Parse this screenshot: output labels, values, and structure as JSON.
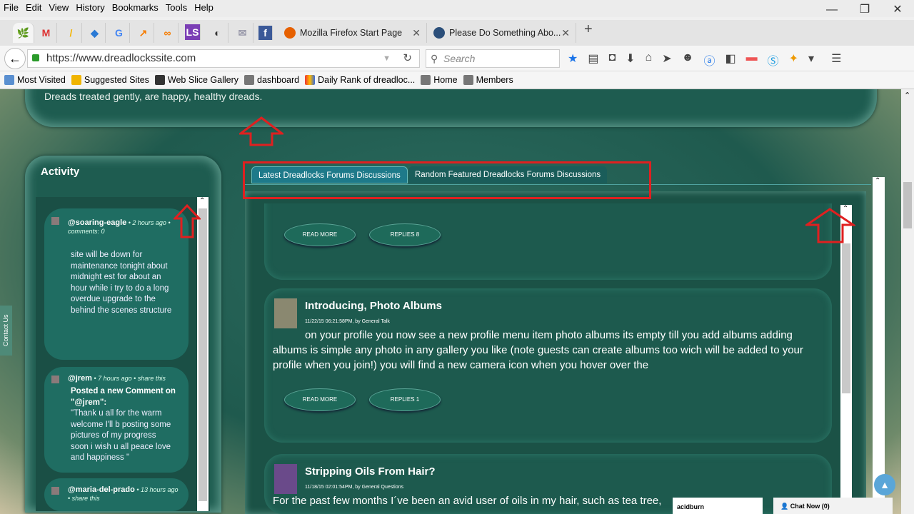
{
  "menu": [
    "File",
    "Edit",
    "View",
    "History",
    "Bookmarks",
    "Tools",
    "Help"
  ],
  "pinned_tabs": [
    "dreadlocks",
    "gmail",
    "adwords",
    "teamviewer",
    "google",
    "analytics",
    "link",
    "ls",
    "globe",
    "mail",
    "facebook"
  ],
  "tabs": [
    {
      "label": "Mozilla Firefox Start Page",
      "close": "✕"
    },
    {
      "label": "Please Do Something Abo...",
      "close": "✕"
    }
  ],
  "new_tab": "+",
  "url": "https://www.dreadlockssite.com",
  "search_placeholder": "Search",
  "bookmarks": [
    "Most Visited",
    "Suggested Sites",
    "Web Slice Gallery",
    "dashboard",
    "Daily Rank of dreadloc...",
    "Home",
    "Members"
  ],
  "page": {
    "top_text": "Dreads treated gently, are happy, healthy dreads.",
    "contact": "Contact Us",
    "activity": {
      "title": "Activity",
      "items": [
        {
          "user": "@soaring-eagle",
          "meta": " • 2 hours ago • comments: 0",
          "body": "site will be down for maintenance tonight about midnight est  for about an hour while i try to do a long overdue upgrade to the behind the scenes structure"
        },
        {
          "user": "@jrem",
          "meta": " • 7 hours ago • share this",
          "lead": "Posted a new Comment on \"@jrem\":",
          "body": "\"Thank u all for the warm welcome I'll b posting some pictures of my progress soon i wish u all peace love and happiness \""
        },
        {
          "user": "@maria-del-prado",
          "meta": " • 13 hours ago • share this",
          "body": ""
        }
      ]
    },
    "tabs": [
      "Latest Dreadlocks Forums Discussions",
      "Random Featured Dreadlocks Forums Discussions"
    ],
    "posts": [
      {
        "read_more": "READ MORE",
        "replies": "REPLIES 8"
      },
      {
        "title": "Introducing, Photo Albums",
        "date": "11/22/15 06:21:58PM, by ",
        "category": "General Talk",
        "excerpt": "on your profile you now see a new profile menu item photo albums its empty till you add albums adding albums is simple any photo in any gallery you like (note guests can create albums too wich will be added to your profile when you join!) you will find a new camera icon when you hover over the",
        "read_more": "READ MORE",
        "replies": "REPLIES 1"
      },
      {
        "title": "Stripping Oils From Hair?",
        "date": "11/18/15 02:01:54PM, by ",
        "category": "General Questions",
        "excerpt": "For the past few months I´ve been an avid user of oils in my hair, such as tea tree, "
      }
    ]
  },
  "chat": {
    "user": "acidburn",
    "label": "Chat Now (0)"
  }
}
